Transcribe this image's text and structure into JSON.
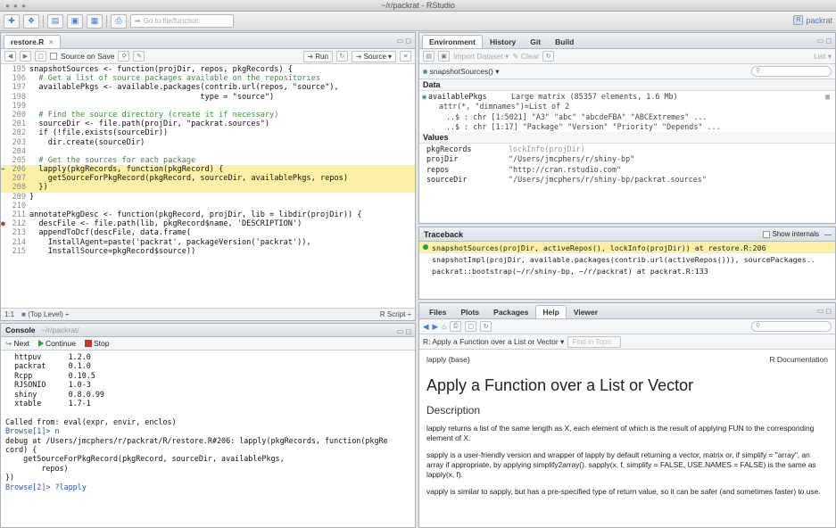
{
  "window": {
    "title": "~/r/packrat - RStudio"
  },
  "toolbar": {
    "goto_placeholder": "Go to file/function",
    "project": "packrat"
  },
  "editor": {
    "tab": "restore.R",
    "source_on_save": "Source on Save",
    "run": "Run",
    "source": "Source",
    "status_pos": "1:1",
    "status_scope": "(Top Level)",
    "status_type": "R Script",
    "lines": [
      {
        "n": "195",
        "t": "snapshotSources <- function(projDir, repos, pkgRecords) {",
        "c": "txt",
        "g": ""
      },
      {
        "n": "196",
        "t": "  # Get a list of source packages available on the repositories",
        "c": "cmt",
        "g": ""
      },
      {
        "n": "197",
        "t": "  availablePkgs <- available.packages(contrib.url(repos, \"source\"),",
        "c": "txt",
        "g": ""
      },
      {
        "n": "198",
        "t": "                                     type = \"source\")",
        "c": "txt",
        "g": ""
      },
      {
        "n": "199",
        "t": "",
        "c": "txt",
        "g": ""
      },
      {
        "n": "200",
        "t": "  # Find the source directory (create it if necessary)",
        "c": "cmt",
        "g": ""
      },
      {
        "n": "201",
        "t": "  sourceDir <- file.path(projDir, \"packrat.sources\")",
        "c": "txt",
        "g": ""
      },
      {
        "n": "202",
        "t": "  if (!file.exists(sourceDir))",
        "c": "txt",
        "g": ""
      },
      {
        "n": "203",
        "t": "    dir.create(sourceDir)",
        "c": "txt",
        "g": ""
      },
      {
        "n": "204",
        "t": "",
        "c": "txt",
        "g": ""
      },
      {
        "n": "205",
        "t": "  # Get the sources for each package",
        "c": "cmt",
        "g": ""
      },
      {
        "n": "206",
        "t": "  lapply(pkgRecords, function(pkgRecord) {",
        "c": "txt",
        "g": "arrow",
        "hl": true
      },
      {
        "n": "207",
        "t": "    getSourceForPkgRecord(pkgRecord, sourceDir, availablePkgs, repos)",
        "c": "txt",
        "g": "",
        "hl": true
      },
      {
        "n": "208",
        "t": "  })",
        "c": "txt",
        "g": "",
        "hl": true
      },
      {
        "n": "209",
        "t": "}",
        "c": "txt",
        "g": ""
      },
      {
        "n": "210",
        "t": "",
        "c": "txt",
        "g": ""
      },
      {
        "n": "211",
        "t": "annotatePkgDesc <- function(pkgRecord, projDir, lib = libdir(projDir)) {",
        "c": "txt",
        "g": ""
      },
      {
        "n": "212",
        "t": "  descFile <- file.path(lib, pkgRecord$name, 'DESCRIPTION')",
        "c": "txt",
        "g": "dot"
      },
      {
        "n": "213",
        "t": "  appendToDcf(descFile, data.frame(",
        "c": "txt",
        "g": ""
      },
      {
        "n": "214",
        "t": "    InstallAgent=paste('packrat', packageVersion('packrat')),",
        "c": "txt",
        "g": ""
      },
      {
        "n": "215",
        "t": "    InstallSource=pkgRecord$source))",
        "c": "txt",
        "g": ""
      }
    ]
  },
  "console": {
    "title": "Console",
    "path": "~/r/packrat/",
    "next": "Next",
    "continue": "Continue",
    "stop": "Stop",
    "lines": [
      "  httpuv      1.2.0",
      "  packrat     0.1.0",
      "  Rcpp        0.10.5",
      "  RJSONIO     1.0-3",
      "  shiny       0.8.0.99",
      "  xtable      1.7-1",
      "",
      "Called from: eval(expr, envir, enclos)",
      "Browse[1]> n",
      "debug at /Users/jmcphers/r/packrat/R/restore.R#206: lapply(pkgRecords, function(pkgRe",
      "cord) {",
      "    getSourceForPkgRecord(pkgRecord, sourceDir, availablePkgs,",
      "        repos)",
      "})",
      "Browse[2]> ?lapply"
    ]
  },
  "environment": {
    "tabs": [
      "Environment",
      "History",
      "Git",
      "Build"
    ],
    "import": "Import Dataset",
    "clear": "Clear",
    "list": "List",
    "scope": "snapshotSources()",
    "data_label": "Data",
    "values_label": "Values",
    "data": [
      {
        "name": "availablePkgs",
        "value": "Large matrix (85357 elements, 1.6 Mb)"
      },
      {
        "name": "",
        "value": "attr(*, \"dimnames\")=List of 2"
      },
      {
        "name": "",
        "value": "..$ : chr [1:5021] \"A3\" \"abc\" \"abcdeFBA\" \"ABCExtremes\" ..."
      },
      {
        "name": "",
        "value": "..$ : chr [1:17] \"Package\" \"Version\" \"Priority\" \"Depends\" ..."
      }
    ],
    "values": [
      {
        "name": "pkgRecords",
        "value": "lockInfo(projDir)",
        "grey": true
      },
      {
        "name": "projDir",
        "value": "\"/Users/jmcphers/r/shiny-bp\""
      },
      {
        "name": "repos",
        "value": "\"http://cran.rstudio.com\""
      },
      {
        "name": "sourceDir",
        "value": "\"/Users/jmcphers/r/shiny-bp/packrat.sources\""
      }
    ]
  },
  "traceback": {
    "title": "Traceback",
    "show_internals": "Show internals",
    "rows": [
      "snapshotSources(projDir, activeRepos(), lockInfo(projDir)) at restore.R:206",
      "snapshotImpl(projDir, available.packages(contrib.url(activeRepos())), sourcePackages..",
      "packrat::bootstrap(~/r/shiny-bp, ~/r/packrat) at packrat.R:133"
    ]
  },
  "help": {
    "tabs": [
      "Files",
      "Plots",
      "Packages",
      "Help",
      "Viewer"
    ],
    "topic_select": "R: Apply a Function over a List or Vector",
    "find_placeholder": "Find in Topic",
    "pkg": "lapply {base}",
    "doc": "R Documentation",
    "title": "Apply a Function over a List or Vector",
    "desc_heading": "Description",
    "p1": "lapply returns a list of the same length as X, each element of which is the result of applying FUN to the corresponding element of X.",
    "p2": "sapply is a user-friendly version and wrapper of lapply by default returning a vector, matrix or, if simplify = \"array\", an array if appropriate, by applying simplify2array(). sapply(x, f, simplify = FALSE, USE.NAMES = FALSE) is the same as lapply(x, f).",
    "p3": "vapply is similar to sapply, but has a pre-specified type of return value, so it can be safer (and sometimes faster) to use."
  }
}
